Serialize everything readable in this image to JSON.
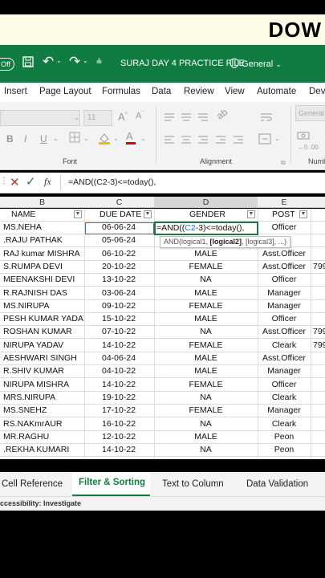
{
  "banner": {
    "text": "DOW"
  },
  "titlebar": {
    "autosave": "Off",
    "filename": "SURAJ DAY 4 PRACTICE FILE",
    "sensitivity": "General"
  },
  "ribbon_tabs": [
    "Insert",
    "Page Layout",
    "Formulas",
    "Data",
    "Review",
    "View",
    "Automate",
    "Dev"
  ],
  "ribbon": {
    "font_size": "11",
    "font_group_label": "Font",
    "alignment_group_label": "Alignment",
    "number_group_label": "Numb",
    "number_format": "General",
    "bold": "B",
    "italic": "I",
    "underline": "U"
  },
  "formula_bar": {
    "fx": "fx",
    "content": "=AND((C2-3)<=today(),"
  },
  "columns": {
    "letters": [
      "B",
      "C",
      "D",
      "E"
    ],
    "headers": [
      "NAME",
      "DUE DATE",
      "GENDER",
      "POST"
    ]
  },
  "rows": [
    {
      "name": "MS.NEHA",
      "due": "06-06-24",
      "gender": "",
      "post": "Officer",
      "extra": ""
    },
    {
      "name": ".RAJU PATHAK",
      "due": "05-06-24",
      "gender": "",
      "post": "",
      "extra": ""
    },
    {
      "name": "RAJ kumar MISHRA",
      "due": "06-10-22",
      "gender": "MALE",
      "post": "Asst.Officer",
      "extra": ""
    },
    {
      "name": "S.RUMPA DEVI",
      "due": "20-10-22",
      "gender": "FEMALE",
      "post": "Asst.Officer",
      "extra": "799"
    },
    {
      "name": "MEENAKSHI DEVI",
      "due": "13-10-22",
      "gender": "NA",
      "post": "Officer",
      "extra": ""
    },
    {
      "name": "R.RAJNISH DAS",
      "due": "03-06-24",
      "gender": "MALE",
      "post": "Manager",
      "extra": ""
    },
    {
      "name": "MS.NIRUPA",
      "due": "09-10-22",
      "gender": "FEMALE",
      "post": "Manager",
      "extra": ""
    },
    {
      "name": "PESH KUMAR YADAV",
      "due": "15-10-22",
      "gender": "MALE",
      "post": "Officer",
      "extra": ""
    },
    {
      "name": "ROSHAN KUMAR",
      "due": "07-10-22",
      "gender": "NA",
      "post": "Asst.Officer",
      "extra": "799"
    },
    {
      "name": "NIRUPA YADAV",
      "due": "14-10-22",
      "gender": "FEMALE",
      "post": "Cleark",
      "extra": "799"
    },
    {
      "name": "AESHWARI SINGH",
      "due": "04-06-24",
      "gender": "MALE",
      "post": "Asst.Officer",
      "extra": ""
    },
    {
      "name": "R.SHIV KUMAR",
      "due": "04-10-22",
      "gender": "MALE",
      "post": "Manager",
      "extra": ""
    },
    {
      "name": "NIRUPA MISHRA",
      "due": "14-10-22",
      "gender": "FEMALE",
      "post": "Officer",
      "extra": ""
    },
    {
      "name": "MRS.NIRUPA",
      "due": "19-10-22",
      "gender": "NA",
      "post": "Cleark",
      "extra": ""
    },
    {
      "name": "MS.SNEHZ",
      "due": "17-10-22",
      "gender": "FEMALE",
      "post": "Manager",
      "extra": ""
    },
    {
      "name": "RS.NAKmrAUR",
      "due": "16-10-22",
      "gender": "NA",
      "post": "Cleark",
      "extra": ""
    },
    {
      "name": "MR.RAGHU",
      "due": "12-10-22",
      "gender": "MALE",
      "post": "Peon",
      "extra": ""
    },
    {
      "name": ".REKHA KUMARI",
      "due": "14-10-22",
      "gender": "NA",
      "post": "Peon",
      "extra": ""
    }
  ],
  "editing_cell": {
    "prefix": "=AND((",
    "ref": "C2",
    "suffix": "-3)<=today(),",
    "tooltip_pre": "AND(logical1, ",
    "tooltip_bold": "[logical2]",
    "tooltip_post": ", [logical3], ...)"
  },
  "sheet_tabs": [
    "Cell Reference",
    "Filter & Sorting",
    "Text to Column",
    "Data Validation"
  ],
  "active_sheet": "Filter & Sorting",
  "status": "ccessibility: Investigate",
  "colors": {
    "excel_green": "#107c41",
    "selection": "#217346",
    "ref_blue": "#1f6fd0"
  }
}
